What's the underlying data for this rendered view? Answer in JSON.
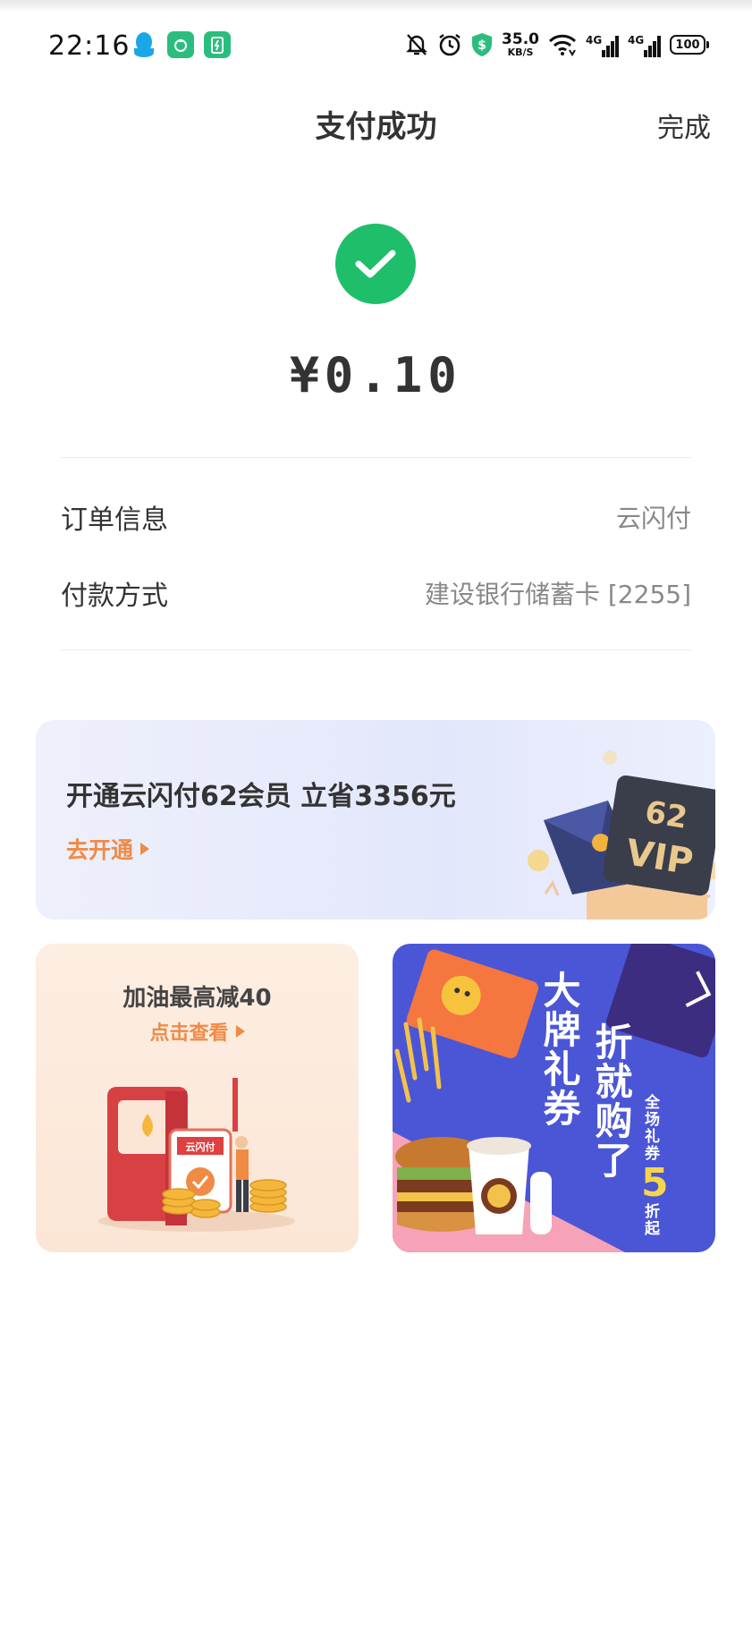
{
  "status_bar": {
    "time": "22:16",
    "net_speed_value": "35.0",
    "net_speed_unit": "KB/S",
    "signal_label_1": "4G",
    "signal_label_2": "4G",
    "battery": "100"
  },
  "header": {
    "title": "支付成功",
    "done_label": "完成"
  },
  "payment": {
    "amount": "¥0.10"
  },
  "info_rows": [
    {
      "label": "订单信息",
      "value": "云闪付"
    },
    {
      "label": "付款方式",
      "value": "建设银行储蓄卡 [2255]"
    }
  ],
  "vip_banner": {
    "title": "开通云闪付62会员 立省3356元",
    "link": "去开通",
    "card_number": "62",
    "card_text": "VIP"
  },
  "promo_fuel": {
    "title": "加油最高减40",
    "link": "点击查看",
    "pump_label": "云闪付"
  },
  "promo_gift": {
    "line1": "大牌礼券",
    "line2": "折就购了",
    "line3": "全场礼券",
    "number": "5",
    "line4": "折起"
  },
  "colors": {
    "success_green": "#1ebe6a",
    "accent_orange": "#f08a45",
    "gift_blue": "#4a56d6"
  }
}
